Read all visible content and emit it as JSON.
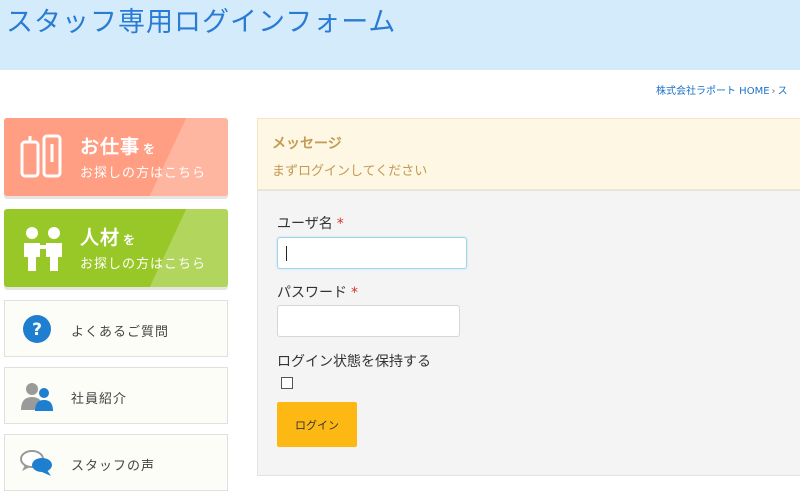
{
  "header": {
    "title": "スタッフ専用ログインフォーム"
  },
  "breadcrumb": {
    "home": "株式会社ラポート HOME",
    "separator": "›",
    "current": "ス"
  },
  "sidebar": {
    "banners": [
      {
        "main": "お仕事",
        "suffix": "を",
        "sub": "お探しの方はこちら",
        "icon": "documents-icon"
      },
      {
        "main": "人材",
        "suffix": "を",
        "sub": "お探しの方はこちら",
        "icon": "people-icon"
      }
    ],
    "links": [
      {
        "label": "よくあるご質問",
        "icon": "question-icon"
      },
      {
        "label": "社員紹介",
        "icon": "staff-icon"
      },
      {
        "label": "スタッフの声",
        "icon": "speech-bubble-icon"
      }
    ]
  },
  "message": {
    "title": "メッセージ",
    "text": "まずログインしてください"
  },
  "form": {
    "username_label": "ユーザ名",
    "required_mark": "*",
    "username_value": "",
    "password_label": "パスワード",
    "password_value": "",
    "remember_label": "ログイン状態を保持する",
    "login_button": "ログイン"
  },
  "colors": {
    "header_bg": "#d4ebfc",
    "title": "#2a7bd4",
    "work_banner": "#ff9e82",
    "talent_banner": "#98c728",
    "message_bg": "#fdf7e4",
    "message_text": "#c39a52",
    "button": "#fdb813",
    "required": "#d9302c"
  }
}
